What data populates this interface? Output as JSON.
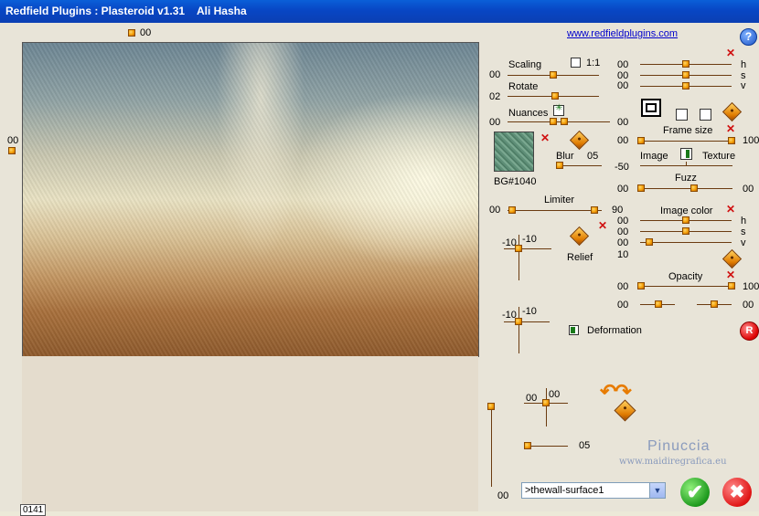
{
  "window": {
    "title": "Redfield Plugins : Plasteroid v1.31    Ali Hasha"
  },
  "link": "www.redfieldplugins.com",
  "help": "?",
  "top_slider": {
    "value": "00"
  },
  "left_slider": {
    "value": "00"
  },
  "scaling": {
    "label": "Scaling",
    "value": "00",
    "ratio_label": "1:1"
  },
  "rotate": {
    "label": "Rotate",
    "value": "02"
  },
  "nuances": {
    "label": "Nuances",
    "left_value": "00",
    "right_value": "00"
  },
  "thumbnail": {
    "caption": "BG#1040"
  },
  "blur": {
    "label": "Blur",
    "value": "05"
  },
  "limiter": {
    "label": "Limiter",
    "left_value": "00",
    "right_value": "90"
  },
  "relief": {
    "label": "Relief",
    "x_value": "-10",
    "y_value": "-10"
  },
  "pad2": {
    "x_value": "-10",
    "y_value": "-10"
  },
  "deformation": {
    "label": "Deformation"
  },
  "pad3": {
    "x_value": "00",
    "y_value": "00"
  },
  "bottom_slider": {
    "value": "05"
  },
  "vertical_slider": {
    "value": "00"
  },
  "hsv_top": {
    "rows": [
      {
        "value": "00",
        "letter": "h"
      },
      {
        "value": "00",
        "letter": "s"
      },
      {
        "value": "00",
        "letter": "v"
      }
    ]
  },
  "frame_size": {
    "label": "Frame size",
    "left_value": "00",
    "right_value": "100"
  },
  "image_texture": {
    "image_label": "Image",
    "texture_label": "Texture",
    "value": "-50"
  },
  "fuzz": {
    "label": "Fuzz",
    "left_value": "00",
    "right_value": "00"
  },
  "image_color": {
    "label": "Image color",
    "rows": [
      {
        "value": "00",
        "letter": "h"
      },
      {
        "value": "00",
        "letter": "s"
      },
      {
        "value": "00",
        "letter": "v"
      }
    ],
    "extra_value": "10"
  },
  "opacity": {
    "label": "Opacity",
    "left_value": "00",
    "right_value": "100",
    "row2_left": "00",
    "row2_right": "00"
  },
  "preset": {
    "selected": ">thewall-surface1"
  },
  "r_button": "R",
  "watermark": {
    "name": "Pinuccia",
    "site": "www.maidiregrafica.eu"
  },
  "status": "0141",
  "colors": {
    "titlebar": "#0846c4",
    "knob": "#f29a00",
    "track": "#6b3b10",
    "close_x": "#d01010"
  }
}
